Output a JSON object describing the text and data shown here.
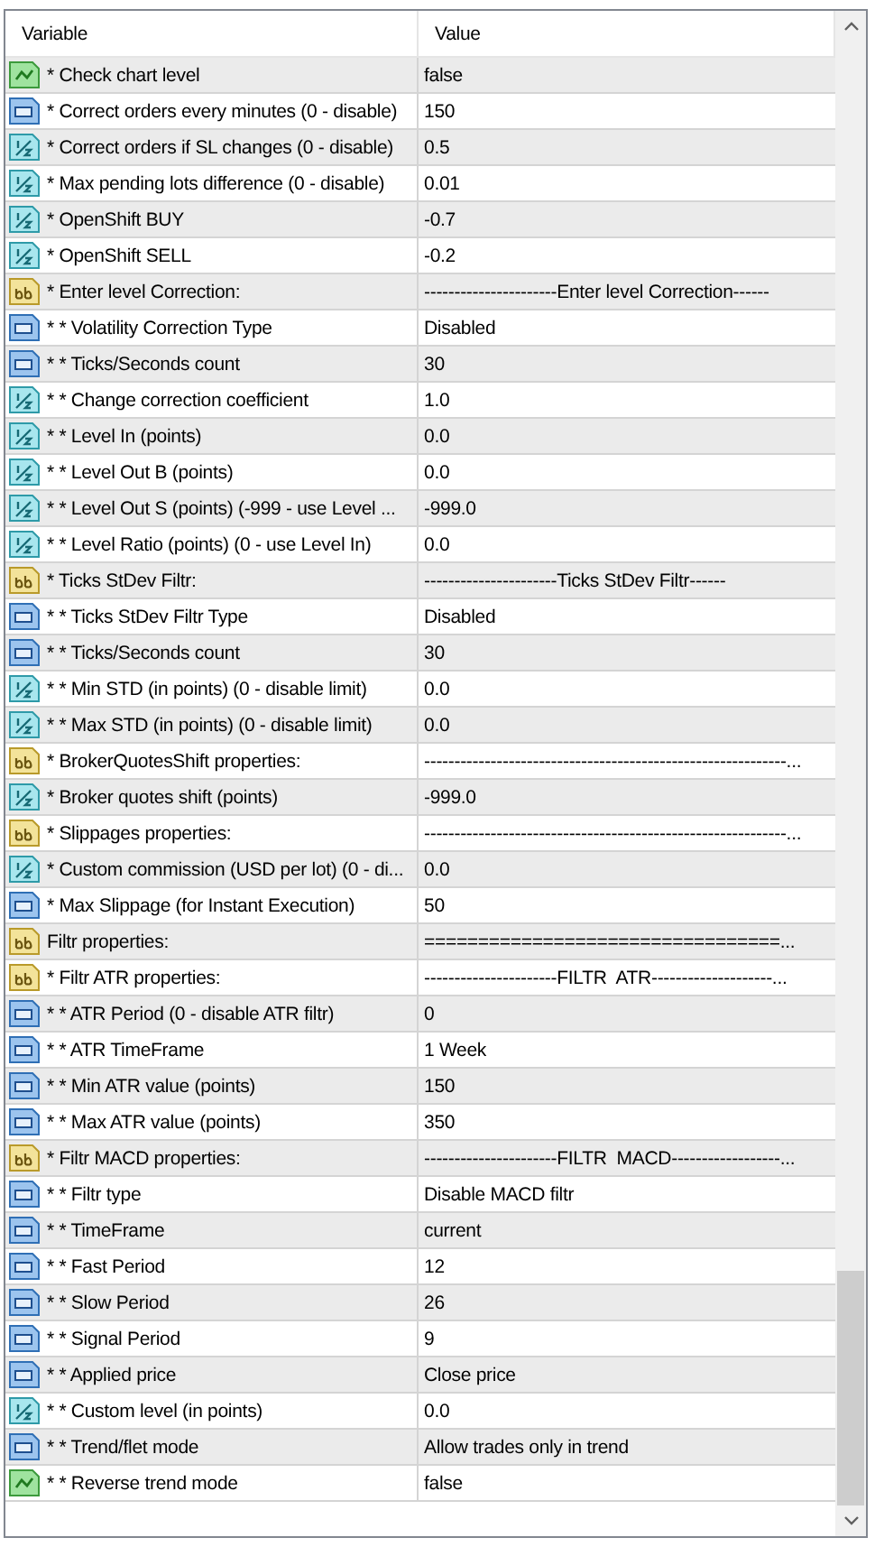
{
  "table": {
    "columns": [
      "Variable",
      "Value"
    ],
    "rows": [
      {
        "kind": "bool",
        "variable": "* Check chart level",
        "value": "false"
      },
      {
        "kind": "int",
        "variable": "* Correct orders every minutes (0 - disable)",
        "value": "150"
      },
      {
        "kind": "double",
        "variable": "* Correct orders if SL changes (0 - disable)",
        "value": "0.5"
      },
      {
        "kind": "double",
        "variable": "* Max pending lots difference (0 - disable)",
        "value": "0.01"
      },
      {
        "kind": "double",
        "variable": "* OpenShift BUY",
        "value": "-0.7"
      },
      {
        "kind": "double",
        "variable": "* OpenShift SELL",
        "value": "-0.2"
      },
      {
        "kind": "string",
        "variable": "* Enter level Correction:",
        "value": "----------------------Enter level Correction------"
      },
      {
        "kind": "int",
        "variable": "* * Volatility Correction Type",
        "value": "Disabled"
      },
      {
        "kind": "int",
        "variable": "* * Ticks/Seconds count",
        "value": "30"
      },
      {
        "kind": "double",
        "variable": "* * Change correction coefficient",
        "value": "1.0"
      },
      {
        "kind": "double",
        "variable": "* * Level In (points)",
        "value": "0.0"
      },
      {
        "kind": "double",
        "variable": "* * Level Out B (points)",
        "value": "0.0"
      },
      {
        "kind": "double",
        "variable": "* * Level Out S (points) (-999 - use Level ...",
        "value": "-999.0"
      },
      {
        "kind": "double",
        "variable": "* * Level Ratio (points) (0 - use Level In)",
        "value": "0.0"
      },
      {
        "kind": "string",
        "variable": "* Ticks StDev Filtr:",
        "value": "----------------------Ticks StDev Filtr------"
      },
      {
        "kind": "int",
        "variable": "* * Ticks StDev Filtr Type",
        "value": "Disabled"
      },
      {
        "kind": "int",
        "variable": "* * Ticks/Seconds count",
        "value": "30"
      },
      {
        "kind": "double",
        "variable": "* * Min STD (in points) (0 - disable limit)",
        "value": "0.0"
      },
      {
        "kind": "double",
        "variable": "* * Max STD (in points) (0 - disable limit)",
        "value": "0.0"
      },
      {
        "kind": "string",
        "variable": "* BrokerQuotesShift properties:",
        "value": "------------------------------------------------------------..."
      },
      {
        "kind": "double",
        "variable": "* Broker quotes shift (points)",
        "value": "-999.0"
      },
      {
        "kind": "string",
        "variable": "* Slippages properties:",
        "value": "------------------------------------------------------------..."
      },
      {
        "kind": "double",
        "variable": "* Custom commission (USD per lot) (0 - di...",
        "value": "0.0"
      },
      {
        "kind": "int",
        "variable": "* Max Slippage (for Instant Execution)",
        "value": "50"
      },
      {
        "kind": "string",
        "variable": "Filtr properties:",
        "value": "=================================..."
      },
      {
        "kind": "string",
        "variable": "* Filtr ATR properties:",
        "value": "----------------------FILTR  ATR--------------------..."
      },
      {
        "kind": "int",
        "variable": "* * ATR Period (0 - disable ATR filtr)",
        "value": "0"
      },
      {
        "kind": "int",
        "variable": "* * ATR TimeFrame",
        "value": "1 Week"
      },
      {
        "kind": "int",
        "variable": "* * Min ATR value (points)",
        "value": "150"
      },
      {
        "kind": "int",
        "variable": "* * Max ATR value (points)",
        "value": "350"
      },
      {
        "kind": "string",
        "variable": "* Filtr MACD properties:",
        "value": "----------------------FILTR  MACD------------------..."
      },
      {
        "kind": "int",
        "variable": "* * Filtr type",
        "value": "Disable MACD filtr"
      },
      {
        "kind": "int",
        "variable": "* * TimeFrame",
        "value": "current"
      },
      {
        "kind": "int",
        "variable": "* * Fast Period",
        "value": "12"
      },
      {
        "kind": "int",
        "variable": "* * Slow Period",
        "value": "26"
      },
      {
        "kind": "int",
        "variable": "* * Signal Period",
        "value": "9"
      },
      {
        "kind": "int",
        "variable": "* * Applied price",
        "value": "Close price"
      },
      {
        "kind": "double",
        "variable": "* * Custom level (in points)",
        "value": "0.0"
      },
      {
        "kind": "int",
        "variable": "* * Trend/flet mode",
        "value": "Allow trades only in trend"
      },
      {
        "kind": "bool",
        "variable": "* * Reverse trend mode",
        "value": "false"
      }
    ]
  }
}
